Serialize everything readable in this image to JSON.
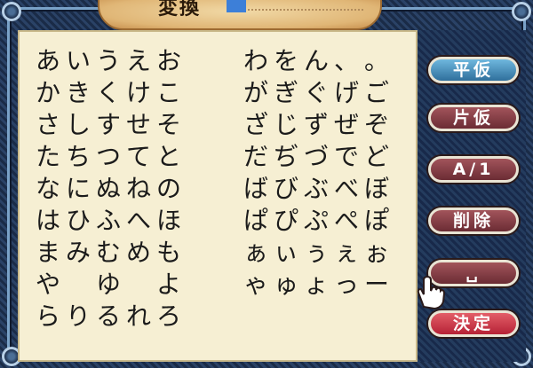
{
  "title": "変換",
  "kana_rows": [
    [
      "あ",
      "い",
      "う",
      "え",
      "お",
      "わ",
      "を",
      "ん",
      "、",
      "。"
    ],
    [
      "か",
      "き",
      "く",
      "け",
      "こ",
      "が",
      "ぎ",
      "ぐ",
      "げ",
      "ご"
    ],
    [
      "さ",
      "し",
      "す",
      "せ",
      "そ",
      "ざ",
      "じ",
      "ず",
      "ぜ",
      "ぞ"
    ],
    [
      "た",
      "ち",
      "つ",
      "て",
      "と",
      "だ",
      "ぢ",
      "づ",
      "で",
      "ど"
    ],
    [
      "な",
      "に",
      "ぬ",
      "ね",
      "の",
      "ば",
      "び",
      "ぶ",
      "べ",
      "ぼ"
    ],
    [
      "は",
      "ひ",
      "ふ",
      "へ",
      "ほ",
      "ぱ",
      "ぴ",
      "ぷ",
      "ぺ",
      "ぽ"
    ],
    [
      "ま",
      "み",
      "む",
      "め",
      "も",
      "ぁ",
      "ぃ",
      "ぅ",
      "ぇ",
      "ぉ"
    ],
    [
      "や",
      "",
      "ゆ",
      "",
      "よ",
      "ゃ",
      "ゅ",
      "ょ",
      "っ",
      "ー"
    ],
    [
      "ら",
      "り",
      "る",
      "れ",
      "ろ",
      "",
      "",
      "",
      "",
      ""
    ]
  ],
  "buttons": {
    "hiragana": "平仮",
    "katakana": "片仮",
    "alnum": "A/1",
    "delete": "削除",
    "space": "␣",
    "confirm": "決定"
  }
}
